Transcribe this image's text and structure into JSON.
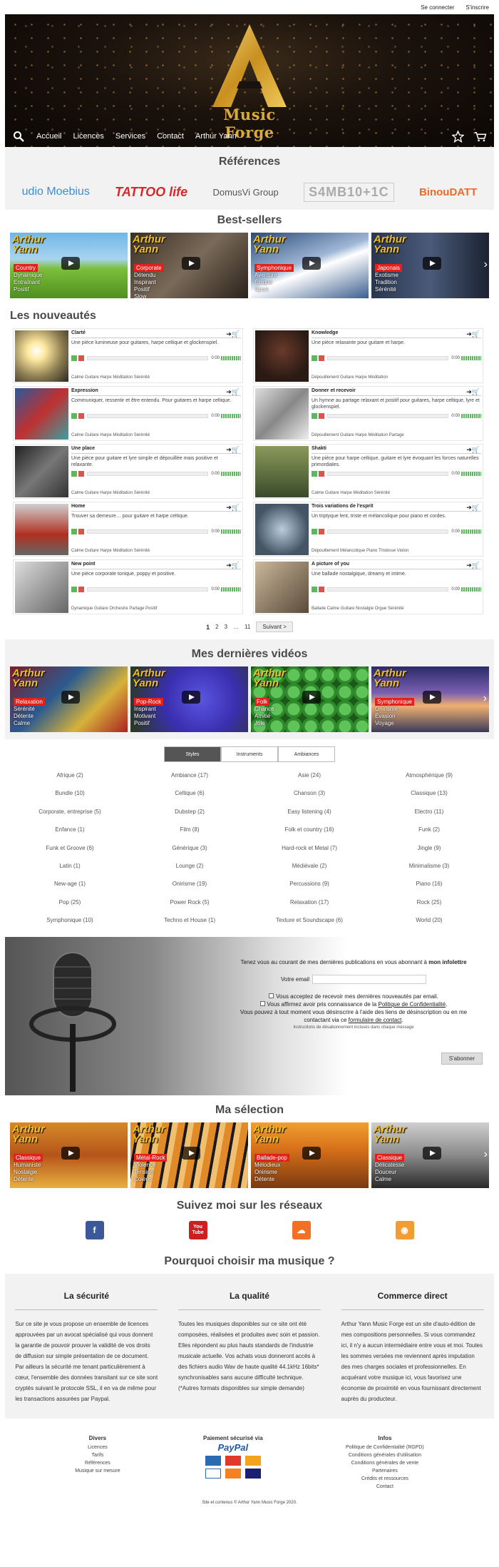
{
  "header": {
    "connect": "Se connecter",
    "signup": "S'inscrire"
  },
  "hero": {
    "brand": "Music Forge"
  },
  "nav": {
    "items": [
      "Accueil",
      "Licences",
      "Services",
      "Contact",
      "Arthur Yann"
    ]
  },
  "references": {
    "title": "Références",
    "logos": [
      "udio Moebius",
      "TATTOO life",
      "DomusVi Group",
      "S4MB10+1C",
      "BinouDATT"
    ]
  },
  "bestsellers": {
    "title": "Best-sellers",
    "cards": [
      {
        "brand": "Arthur\nYann",
        "tag": "Country",
        "moods": "Dynamique\nEntraînant\nPositif"
      },
      {
        "brand": "Arthur\nYann",
        "tag": "Corporate",
        "moods": "Détendu\nInspirant\nPositif\nSlow"
      },
      {
        "brand": "Arthur\nYann",
        "tag": "Symphonique",
        "moods": "Aventure\nÉpique\nSport"
      },
      {
        "brand": "Arthur\nYann",
        "tag": "Japonais",
        "moods": "Exotisme\nTradition\nSérénité"
      }
    ]
  },
  "news": {
    "title": "Les nouveautés",
    "tracks": [
      {
        "title": "Clarté",
        "desc": "Une pièce lumineuse pour guitares, harpe celtique et glockenspiel.",
        "time": "0:00",
        "tags": "Calme Guitare Harpe Méditation Sérénité"
      },
      {
        "title": "Knowledge",
        "desc": "Une pièce relaxante pour guitare et harpe.",
        "time": "0:00",
        "tags": "Dépouillement Guitare Harpe Méditation"
      },
      {
        "title": "Expression",
        "desc": "Communiquer, ressentir et être entendu. Pour guitares et harpe celtique.",
        "time": "0:00",
        "tags": "Calme Guitare Harpe Méditation Sérénité"
      },
      {
        "title": "Donner et recevoir",
        "desc": "Un hymne au partage relaxant et positif pour guitares, harpe celtique, lyre et glockenspiel.",
        "time": "0:00",
        "tags": "Dépouillement Guitare Harpe Méditation Partage"
      },
      {
        "title": "Une place",
        "desc": "Une pièce pour guitare et lyre simple et dépouillée mais positive et relaxante.",
        "time": "0:00",
        "tags": "Calme Guitare Harpe Méditation Sérénité"
      },
      {
        "title": "Shakti",
        "desc": "Une pièce pour harpe celtique, guitare et lyre évoquant les forces naturelles primordiales.",
        "time": "0:00",
        "tags": "Calme Guitare Harpe Méditation Sérénité"
      },
      {
        "title": "Home",
        "desc": "Trouver sa demeure… pour guitare et harpe celtique.",
        "time": "0:00",
        "tags": "Calme Guitare Harpe Méditation Sérénité"
      },
      {
        "title": "Trois variations de l'esprit",
        "desc": "Un triptyque lent, triste et mélancolique pour piano et cordes.",
        "time": "0:00",
        "tags": "Dépouillement Mélancolique Piano Tristesse Violon"
      },
      {
        "title": "New point",
        "desc": "Une pièce corporate tonique, poppy et positive.",
        "time": "0:00",
        "tags": "Dynamique Guitare Orchestre Partage Positif"
      },
      {
        "title": "A picture of you",
        "desc": "Une ballade nostalgique, dreamy et intime.",
        "time": "0:00",
        "tags": "Ballade Calme Guitare Nostalgie Orgue Sérénité"
      }
    ]
  },
  "pager": {
    "p1": "1",
    "p2": "2",
    "p3": "3",
    "dots": "…",
    "last": "11",
    "next": "Suivant >"
  },
  "videos": {
    "title": "Mes dernières vidéos",
    "cards": [
      {
        "brand": "Arthur\nYann",
        "tag": "Relaxation",
        "moods": "Sérénité\nDétente\nCalme"
      },
      {
        "brand": "Arthur\nYann",
        "tag": "Pop-Rock",
        "moods": "Inspirant\nMotivant\nPositif"
      },
      {
        "brand": "Arthur\nYann",
        "tag": "Folk",
        "moods": "Chance\nAmitié\nJoie"
      },
      {
        "brand": "Arthur\nYann",
        "tag": "Symphonique",
        "moods": "Onirisme\nÉvasion\nVoyage"
      }
    ]
  },
  "filters": {
    "tabs": [
      "Styles",
      "Instruments",
      "Ambiances"
    ],
    "genres": [
      "Afrique (2)",
      "Ambiance (17)",
      "Asie (24)",
      "Atmosphérique (9)",
      "Bundle (10)",
      "Celtique (6)",
      "Chanson (3)",
      "Classique (13)",
      "Corporate, entreprise (5)",
      "Dubstep (2)",
      "Easy listening (4)",
      "Electro (11)",
      "Enfance (1)",
      "Film (8)",
      "Folk et country (16)",
      "Funk (2)",
      "Funk et Groove (6)",
      "Générique (3)",
      "Hard-rock et Metal (7)",
      "Jingle (9)",
      "Latin (1)",
      "Lounge (2)",
      "Médiévale (2)",
      "Minimalisme (3)",
      "New-age (1)",
      "Onirisme (19)",
      "Percussions (9)",
      "Piano (16)",
      "Pop (25)",
      "Power Rock (5)",
      "Relaxation (17)",
      "Rock (25)",
      "Symphonique (10)",
      "Techno et House (1)",
      "Texture et Soundscape (6)",
      "World (20)"
    ]
  },
  "newsletter": {
    "intro": "Tenez vous au courant de mes dernières publications en vous abonnant à",
    "intro_bold": "mon infolettre",
    "email_label": "Votre email",
    "consent1": "Vous acceptez de recevoir mes dernières nouveautés par email.",
    "consent2": "Vous affirmez avoir pris connaissance de la",
    "privacy_link": "Politique de Confidentialité",
    "unsub": "Vous pouvez à tout moment vous désinscrire à l'aide des liens de désinscription ou en me contactant via ce",
    "form_link": "formulaire de contact",
    "small": "Instructions de désabonnement incluses dans chaque message",
    "button": "S'abonner"
  },
  "selection": {
    "title": "Ma sélection",
    "cards": [
      {
        "brand": "Arthur\nYann",
        "tag": "Classique",
        "moods": "Humaniste\nNostalgie\nDétente"
      },
      {
        "brand": "Arthur\nYann",
        "tag": "Métal-Rock",
        "moods": "Violence\nTension\nColère"
      },
      {
        "brand": "Arthur\nYann",
        "tag": "Ballade-pop",
        "moods": "Mélodieux\nOnirisme\nDétente"
      },
      {
        "brand": "Arthur\nYann",
        "tag": "Classique",
        "moods": "Délicatesse\nDouceur\nCalme"
      }
    ]
  },
  "social": {
    "title": "Suivez moi sur les réseaux",
    "icons": [
      "f",
      "You Tube",
      "☁",
      "◉"
    ]
  },
  "why": {
    "title": "Pourquoi choisir ma musique ?",
    "cols": [
      {
        "title": "La sécurité",
        "text": "Sur ce site je vous propose un ensemble de licences approuvées par un avocat spécialisé qui vous donnent la garantie de pouvoir prouver la validité de vos droits de diffusion sur simple présentation de ce document. Par ailleurs la sécurité me tenant particulièrement à cœur, l'ensemble des données transitant sur ce site sont cryptés suivant le protocole SSL, il en va de même pour les transactions assurées par Paypal."
      },
      {
        "title": "La qualité",
        "text": "Toutes les musiques disponibles sur ce site ont été composées, réalisées et produites avec soin et passion. Elles répondent au plus hauts standards de l'industrie musicale actuelle. Vos achats vous donneront accès à des fichiers audio Wav de haute qualité 44.1kHz 16bits* synchronisables sans aucune difficulté technique. (*Autres formats disponibles sur simple demande)"
      },
      {
        "title": "Commerce direct",
        "text": "Arthur Yann Music Forge est un site d'auto-édition de mes compositions personnelles. Si vous commandez ici, il n'y a aucun intermédiaire entre vous et moi. Toutes les sommes versées me reviennent après imputation des mes charges sociales et professionnelles. En acquérant votre musique ici, vous favorisez une économie de proximité en vous fournissant directement auprès du producteur."
      }
    ]
  },
  "footer": {
    "divers": {
      "title": "Divers",
      "links": [
        "Licences",
        "Tarifs",
        "Références",
        "Musique sur mesure"
      ]
    },
    "pay": {
      "title": "Paiement sécurisé via",
      "brand": "PayPal"
    },
    "info": {
      "title": "Infos",
      "links": [
        "Politique de Confidentialité (RGPD)",
        "Conditions générales d'utilisation",
        "Conditions générales de vente",
        "Partenaires",
        "Crédits et ressources",
        "Contact"
      ]
    },
    "copyright": "Site et contenus © Arthur Yann Music Forge 2020."
  }
}
